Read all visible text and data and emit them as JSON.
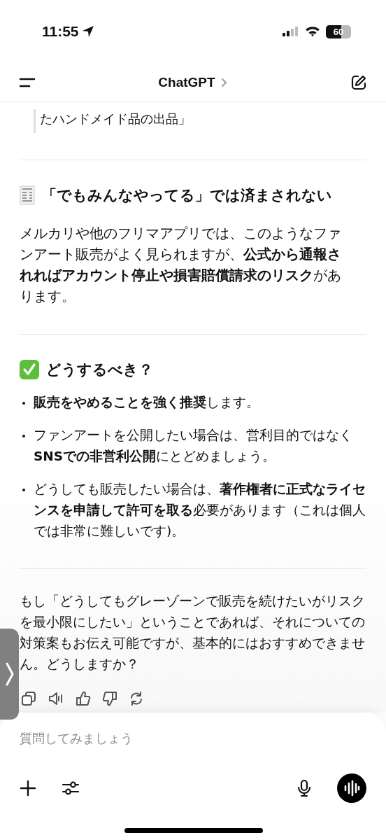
{
  "status_bar": {
    "time": "11:55",
    "battery": "60"
  },
  "header": {
    "title": "ChatGPT"
  },
  "quote": {
    "text": "たハンドメイド品の出品」"
  },
  "sections": [
    {
      "kind": "receipt",
      "heading": "「でもみんなやってる」では済まされない",
      "paragraph": "メルカリや他のフリマアプリでは、このようなファンアート販売がよく見られますが、**公式から通報されればアカウント停止や損害賠償請求のリスク**があります。"
    },
    {
      "kind": "check",
      "heading": "どうするべき？",
      "bullets": [
        "**販売をやめることを強く推奨**します。",
        "ファンアートを公開したい場合は、営利目的ではなく**SNSでの非営利公開**にとどめましょう。",
        "どうしても販売したい場合は、**著作権者に正式なライセンスを申請して許可を取る**必要があります（これは個人では非常に難しいです)。"
      ]
    }
  ],
  "closing": "もし「どうしてもグレーゾーンで販売を続けたいがリスクを最小限にしたい」ということであれば、それについての対策案もお伝え可能ですが、基本的にはおすすめできません。どうしますか？",
  "composer": {
    "placeholder": "質問してみましょう"
  }
}
